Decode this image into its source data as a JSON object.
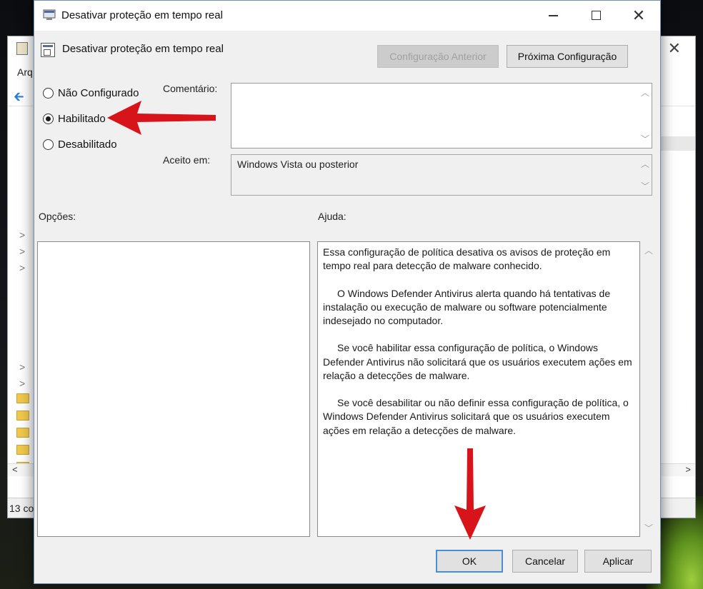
{
  "background_window": {
    "menu_partial": "Arq",
    "status_partial": "13 co",
    "left_tree_chevrons": [
      ">",
      ">",
      ">",
      ">",
      ">"
    ]
  },
  "dialog": {
    "title": "Desativar proteção em tempo real",
    "header_title": "Desativar proteção em tempo real",
    "buttons": {
      "previous": "Configuração Anterior",
      "next": "Próxima Configuração",
      "ok": "OK",
      "cancel": "Cancelar",
      "apply": "Aplicar"
    },
    "state_options": [
      {
        "label": "Não Configurado",
        "selected": false
      },
      {
        "label": "Habilitado",
        "selected": true
      },
      {
        "label": "Desabilitado",
        "selected": false
      }
    ],
    "comment_label": "Comentário:",
    "comment_value": "",
    "supported_label": "Aceito em:",
    "supported_value": "Windows Vista ou posterior",
    "options_label": "Opções:",
    "help_label": "Ajuda:",
    "help_paragraphs": [
      "Essa configuração de política desativa os avisos de proteção em tempo real para detecção de malware conhecido.",
      "O Windows Defender Antivirus alerta quando há tentativas de instalação ou execução de malware ou software potencialmente indesejado no computador.",
      "Se você habilitar essa configuração de política, o Windows Defender Antivirus não solicitará que os usuários executem ações em relação a detecções de malware.",
      "Se você desabilitar ou não definir essa configuração de política, o Windows Defender Antivirus solicitará que os usuários executem ações em relação a detecções de malware."
    ]
  },
  "colors": {
    "annotation_arrow": "#d7141a",
    "default_button_border": "#4a8fd4"
  },
  "icons": {
    "window": "policy-window-icon",
    "header": "policy-setting-icon",
    "back": "back-arrow-icon",
    "folder": "folder-icon"
  }
}
